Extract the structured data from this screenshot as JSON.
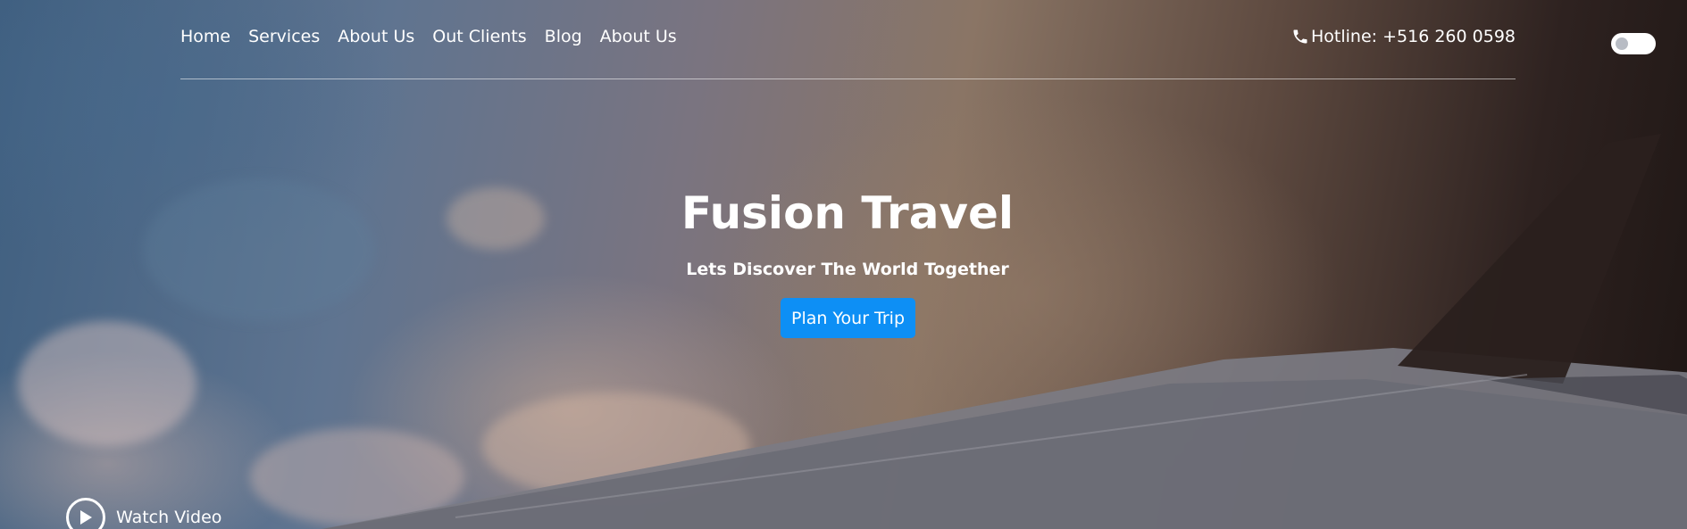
{
  "nav": {
    "items": [
      {
        "label": "Home"
      },
      {
        "label": "Services"
      },
      {
        "label": "About Us"
      },
      {
        "label": "Out Clients"
      },
      {
        "label": "Blog"
      },
      {
        "label": "About Us"
      }
    ]
  },
  "contact": {
    "hotline": "Hotline: +516 260 0598",
    "icon": "phone-icon"
  },
  "theme_toggle": {
    "state": "off"
  },
  "hero": {
    "title": "Fusion Travel",
    "subtitle": "Lets Discover The World Together",
    "cta_label": "Plan Your Trip",
    "watch_label": "Watch Video",
    "watch_icon": "play-icon"
  },
  "colors": {
    "accent": "#0d8ff5",
    "text": "#ffffff"
  }
}
